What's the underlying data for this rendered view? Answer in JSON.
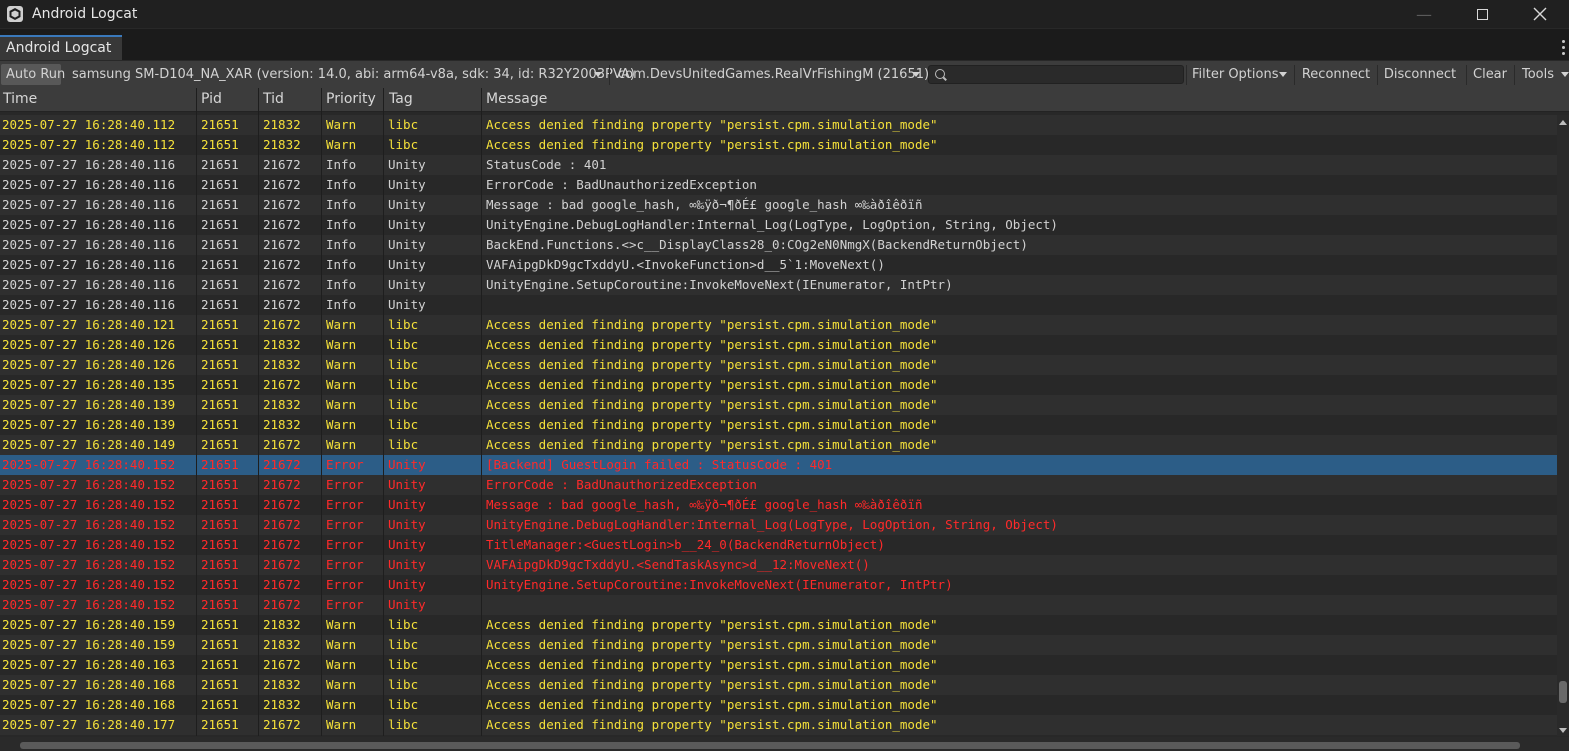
{
  "window": {
    "title": "Android Logcat"
  },
  "tab": {
    "label": "Android Logcat"
  },
  "toolbar": {
    "auto_run": "Auto Run",
    "device": "samsung SM-D104_NA_XAR (version: 14.0, abi: arm64-v8a, sdk: 34, id: R32Y2003PVA)",
    "package": "com.DevsUnitedGames.RealVrFishingM (21651)",
    "search_value": "",
    "filter_options": "Filter Options",
    "reconnect": "Reconnect",
    "disconnect": "Disconnect",
    "clear": "Clear",
    "tools": "Tools"
  },
  "columns": {
    "time": "Time",
    "pid": "Pid",
    "tid": "Tid",
    "priority": "Priority",
    "tag": "Tag",
    "message": "Message"
  },
  "selected_row": 17,
  "rows": [
    {
      "time": "2025-07-27 16:28:40.112",
      "pid": "21651",
      "tid": "21832",
      "priority": "Warn",
      "tag": "libc",
      "message": "Access denied finding property \"persist.cpm.simulation_mode\""
    },
    {
      "time": "2025-07-27 16:28:40.112",
      "pid": "21651",
      "tid": "21832",
      "priority": "Warn",
      "tag": "libc",
      "message": "Access denied finding property \"persist.cpm.simulation_mode\""
    },
    {
      "time": "2025-07-27 16:28:40.116",
      "pid": "21651",
      "tid": "21672",
      "priority": "Info",
      "tag": "Unity",
      "message": "StatusCode : 401"
    },
    {
      "time": "2025-07-27 16:28:40.116",
      "pid": "21651",
      "tid": "21672",
      "priority": "Info",
      "tag": "Unity",
      "message": "ErrorCode : BadUnauthorizedException"
    },
    {
      "time": "2025-07-27 16:28:40.116",
      "pid": "21651",
      "tid": "21672",
      "priority": "Info",
      "tag": "Unity",
      "message": "Message : bad google_hash, ∞‰ÿð¬¶ðÉ£ google_hash ∞‰àðîêðïñ"
    },
    {
      "time": "2025-07-27 16:28:40.116",
      "pid": "21651",
      "tid": "21672",
      "priority": "Info",
      "tag": "Unity",
      "message": "UnityEngine.DebugLogHandler:Internal_Log(LogType, LogOption, String, Object)"
    },
    {
      "time": "2025-07-27 16:28:40.116",
      "pid": "21651",
      "tid": "21672",
      "priority": "Info",
      "tag": "Unity",
      "message": "BackEnd.Functions.<>c__DisplayClass28_0:COg2eN0NmgX(BackendReturnObject)"
    },
    {
      "time": "2025-07-27 16:28:40.116",
      "pid": "21651",
      "tid": "21672",
      "priority": "Info",
      "tag": "Unity",
      "message": "VAFAipgDkD9gcTxddyU.<InvokeFunction>d__5`1:MoveNext()"
    },
    {
      "time": "2025-07-27 16:28:40.116",
      "pid": "21651",
      "tid": "21672",
      "priority": "Info",
      "tag": "Unity",
      "message": "UnityEngine.SetupCoroutine:InvokeMoveNext(IEnumerator, IntPtr)"
    },
    {
      "time": "2025-07-27 16:28:40.116",
      "pid": "21651",
      "tid": "21672",
      "priority": "Info",
      "tag": "Unity",
      "message": ""
    },
    {
      "time": "2025-07-27 16:28:40.121",
      "pid": "21651",
      "tid": "21672",
      "priority": "Warn",
      "tag": "libc",
      "message": "Access denied finding property \"persist.cpm.simulation_mode\""
    },
    {
      "time": "2025-07-27 16:28:40.126",
      "pid": "21651",
      "tid": "21832",
      "priority": "Warn",
      "tag": "libc",
      "message": "Access denied finding property \"persist.cpm.simulation_mode\""
    },
    {
      "time": "2025-07-27 16:28:40.126",
      "pid": "21651",
      "tid": "21832",
      "priority": "Warn",
      "tag": "libc",
      "message": "Access denied finding property \"persist.cpm.simulation_mode\""
    },
    {
      "time": "2025-07-27 16:28:40.135",
      "pid": "21651",
      "tid": "21672",
      "priority": "Warn",
      "tag": "libc",
      "message": "Access denied finding property \"persist.cpm.simulation_mode\""
    },
    {
      "time": "2025-07-27 16:28:40.139",
      "pid": "21651",
      "tid": "21832",
      "priority": "Warn",
      "tag": "libc",
      "message": "Access denied finding property \"persist.cpm.simulation_mode\""
    },
    {
      "time": "2025-07-27 16:28:40.139",
      "pid": "21651",
      "tid": "21832",
      "priority": "Warn",
      "tag": "libc",
      "message": "Access denied finding property \"persist.cpm.simulation_mode\""
    },
    {
      "time": "2025-07-27 16:28:40.149",
      "pid": "21651",
      "tid": "21672",
      "priority": "Warn",
      "tag": "libc",
      "message": "Access denied finding property \"persist.cpm.simulation_mode\""
    },
    {
      "time": "2025-07-27 16:28:40.152",
      "pid": "21651",
      "tid": "21672",
      "priority": "Error",
      "tag": "Unity",
      "message": "[Backend] GuestLogin failed : StatusCode : 401"
    },
    {
      "time": "2025-07-27 16:28:40.152",
      "pid": "21651",
      "tid": "21672",
      "priority": "Error",
      "tag": "Unity",
      "message": "ErrorCode : BadUnauthorizedException"
    },
    {
      "time": "2025-07-27 16:28:40.152",
      "pid": "21651",
      "tid": "21672",
      "priority": "Error",
      "tag": "Unity",
      "message": "Message : bad google_hash, ∞‰ÿð¬¶ðÉ£ google_hash ∞‰àðîêðïñ"
    },
    {
      "time": "2025-07-27 16:28:40.152",
      "pid": "21651",
      "tid": "21672",
      "priority": "Error",
      "tag": "Unity",
      "message": "UnityEngine.DebugLogHandler:Internal_Log(LogType, LogOption, String, Object)"
    },
    {
      "time": "2025-07-27 16:28:40.152",
      "pid": "21651",
      "tid": "21672",
      "priority": "Error",
      "tag": "Unity",
      "message": "TitleManager:<GuestLogin>b__24_0(BackendReturnObject)"
    },
    {
      "time": "2025-07-27 16:28:40.152",
      "pid": "21651",
      "tid": "21672",
      "priority": "Error",
      "tag": "Unity",
      "message": "VAFAipgDkD9gcTxddyU.<SendTaskAsync>d__12:MoveNext()"
    },
    {
      "time": "2025-07-27 16:28:40.152",
      "pid": "21651",
      "tid": "21672",
      "priority": "Error",
      "tag": "Unity",
      "message": "UnityEngine.SetupCoroutine:InvokeMoveNext(IEnumerator, IntPtr)"
    },
    {
      "time": "2025-07-27 16:28:40.152",
      "pid": "21651",
      "tid": "21672",
      "priority": "Error",
      "tag": "Unity",
      "message": ""
    },
    {
      "time": "2025-07-27 16:28:40.159",
      "pid": "21651",
      "tid": "21832",
      "priority": "Warn",
      "tag": "libc",
      "message": "Access denied finding property \"persist.cpm.simulation_mode\""
    },
    {
      "time": "2025-07-27 16:28:40.159",
      "pid": "21651",
      "tid": "21832",
      "priority": "Warn",
      "tag": "libc",
      "message": "Access denied finding property \"persist.cpm.simulation_mode\""
    },
    {
      "time": "2025-07-27 16:28:40.163",
      "pid": "21651",
      "tid": "21672",
      "priority": "Warn",
      "tag": "libc",
      "message": "Access denied finding property \"persist.cpm.simulation_mode\""
    },
    {
      "time": "2025-07-27 16:28:40.168",
      "pid": "21651",
      "tid": "21832",
      "priority": "Warn",
      "tag": "libc",
      "message": "Access denied finding property \"persist.cpm.simulation_mode\""
    },
    {
      "time": "2025-07-27 16:28:40.168",
      "pid": "21651",
      "tid": "21832",
      "priority": "Warn",
      "tag": "libc",
      "message": "Access denied finding property \"persist.cpm.simulation_mode\""
    },
    {
      "time": "2025-07-27 16:28:40.177",
      "pid": "21651",
      "tid": "21672",
      "priority": "Warn",
      "tag": "libc",
      "message": "Access denied finding property \"persist.cpm.simulation_mode\""
    }
  ],
  "colors": {
    "info": "#d2d2d2",
    "warn": "#f4e03a",
    "error": "#ff2a2a",
    "selection": "#2c5d87",
    "accent": "#3a79bb"
  },
  "icons": {
    "app": "unity-logo-icon",
    "search": "search-icon",
    "menu": "kebab-menu-icon"
  }
}
